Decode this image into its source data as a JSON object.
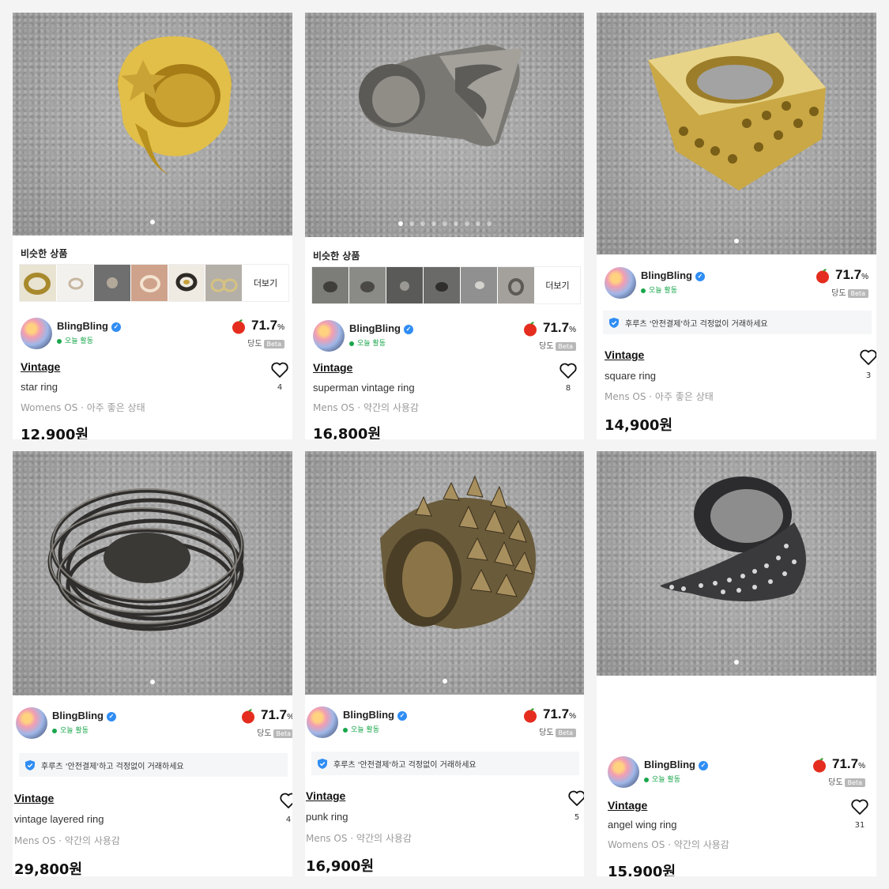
{
  "similar_label": "비슷한 상품",
  "more_label": "더보기",
  "seller": {
    "name": "BlingBling",
    "activity": "오늘 활동",
    "score": "71.7",
    "score_unit": "%",
    "dangdo_label": "당도",
    "beta_label": "Beta"
  },
  "safe_payment_text": "후루츠 '안전결제'하고 걱정없이 거래하세요",
  "products": [
    {
      "brand": "Vintage",
      "name": "star ring",
      "meta": "Womens OS · 아주 좋은 상태",
      "price": "12,900원",
      "likes": "4",
      "ring_color": "#d9b23a"
    },
    {
      "brand": "Vintage",
      "name": "superman vintage ring",
      "meta": "Mens OS · 약간의 사용감",
      "price": "16,800원",
      "likes": "8",
      "ring_color": "#8c8a84"
    },
    {
      "brand": "Vintage",
      "name": "square ring",
      "meta": "Mens OS · 아주 좋은 상태",
      "price": "14,900원",
      "likes": "3",
      "ring_color": "#d8b85a"
    },
    {
      "brand": "Vintage",
      "name": "vintage layered ring",
      "meta": "Mens OS · 약간의 사용감",
      "price": "29,800원",
      "likes": "4",
      "ring_color": "#3c3a38"
    },
    {
      "brand": "Vintage",
      "name": "punk ring",
      "meta": "Mens OS · 약간의 사용감",
      "price": "16,900원",
      "likes": "5",
      "ring_color": "#6e5a32"
    },
    {
      "brand": "Vintage",
      "name": "angel wing ring",
      "meta": "Womens OS · 약간의 사용감",
      "price": "15,900원",
      "likes": "31",
      "ring_color": "#2c2c2e"
    }
  ],
  "icons": {
    "heart": "heart-icon",
    "apple": "apple-icon",
    "verified": "verified-badge-icon",
    "shield": "shield-check-icon"
  },
  "colors": {
    "activity_green": "#19a64b",
    "verified_blue": "#2f8df4",
    "apple_red": "#e52d1f"
  }
}
